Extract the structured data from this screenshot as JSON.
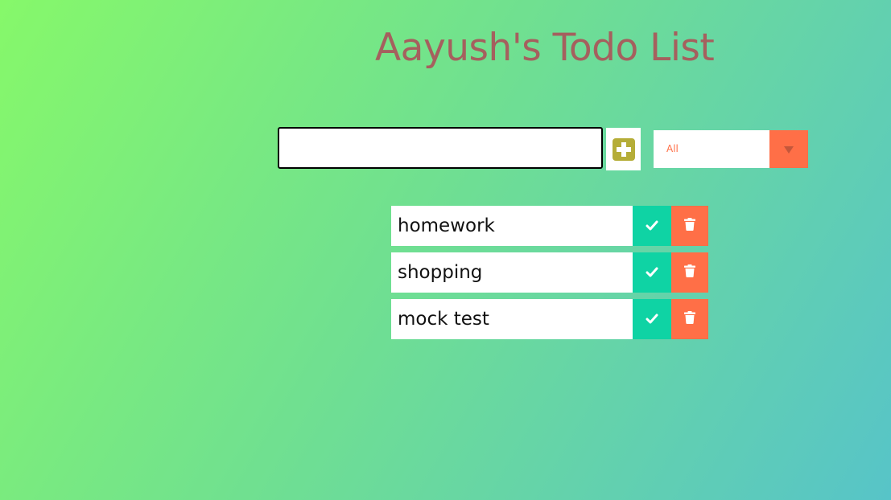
{
  "header": {
    "title": "Aayush's Todo List"
  },
  "form": {
    "input_value": "",
    "add_icon": "plus-square-icon",
    "add_icon_color": "#b5ad38"
  },
  "filter": {
    "selected": "All",
    "arrow_icon": "caret-down-icon"
  },
  "todos": [
    {
      "text": "homework",
      "complete_icon": "check-icon",
      "delete_icon": "trash-icon"
    },
    {
      "text": "shopping",
      "complete_icon": "check-icon",
      "delete_icon": "trash-icon"
    },
    {
      "text": "mock test",
      "complete_icon": "check-icon",
      "delete_icon": "trash-icon"
    }
  ],
  "colors": {
    "title": "#a5605e",
    "complete": "#0fd3a4",
    "delete": "#ff6f47",
    "filter_text": "#ff6f47"
  }
}
